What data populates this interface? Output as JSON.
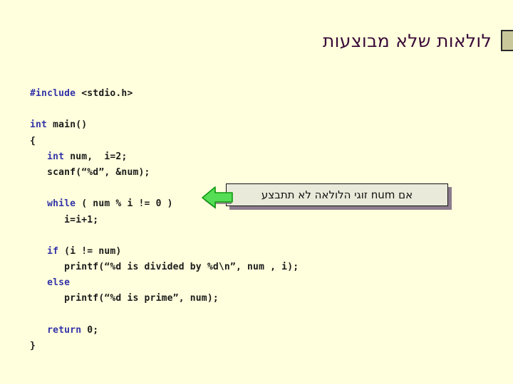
{
  "slide": {
    "title": "לולאות שלא מבוצעות",
    "background_color": "#ffffdd",
    "title_color": "#3a0a39"
  },
  "decoration": {
    "square_fill": "#c8c89a",
    "square_border": "#2b2b2b"
  },
  "code": {
    "keyword_color": "#3333aa",
    "text_color": "#1a1a1a",
    "lines": [
      {
        "id": "l1",
        "kw": "#include",
        "rest": " <stdio.h>"
      },
      {
        "id": "l2",
        "kw": "",
        "rest": ""
      },
      {
        "id": "l3",
        "kw": "int",
        "rest": " main()"
      },
      {
        "id": "l4",
        "kw": "",
        "rest": "{"
      },
      {
        "id": "l5",
        "kw": "   int",
        "rest": " num,  i=2;"
      },
      {
        "id": "l6",
        "kw": "",
        "rest": "   scanf(“%d”, &num);"
      },
      {
        "id": "l7",
        "kw": "",
        "rest": ""
      },
      {
        "id": "l8",
        "kw": "   while",
        "rest": " ( num % i != 0 )"
      },
      {
        "id": "l9",
        "kw": "",
        "rest": "      i=i+1;"
      },
      {
        "id": "l10",
        "kw": "",
        "rest": ""
      },
      {
        "id": "l11",
        "kw": "   if",
        "rest": " (i != num)"
      },
      {
        "id": "l12",
        "kw": "",
        "rest": "      printf(“%d is divided by %d\\n”, num , i);"
      },
      {
        "id": "l13",
        "kw": "   else",
        "rest": ""
      },
      {
        "id": "l14",
        "kw": "",
        "rest": "      printf(“%d is prime”, num);"
      },
      {
        "id": "l15",
        "kw": "",
        "rest": ""
      },
      {
        "id": "l16",
        "kw": "   return",
        "rest": " 0;"
      },
      {
        "id": "l17",
        "kw": "",
        "rest": "}"
      }
    ]
  },
  "callout": {
    "text": "אם num זוגי הלולאה לא תתבצע",
    "box_fill": "#eaeada",
    "box_border": "#121212",
    "shadow_color": "#8d7d8d",
    "arrow_fill": "#55dd55",
    "arrow_stroke": "#119911",
    "arrow_shadow": "#7a6a7a",
    "arrow_direction": "left"
  }
}
